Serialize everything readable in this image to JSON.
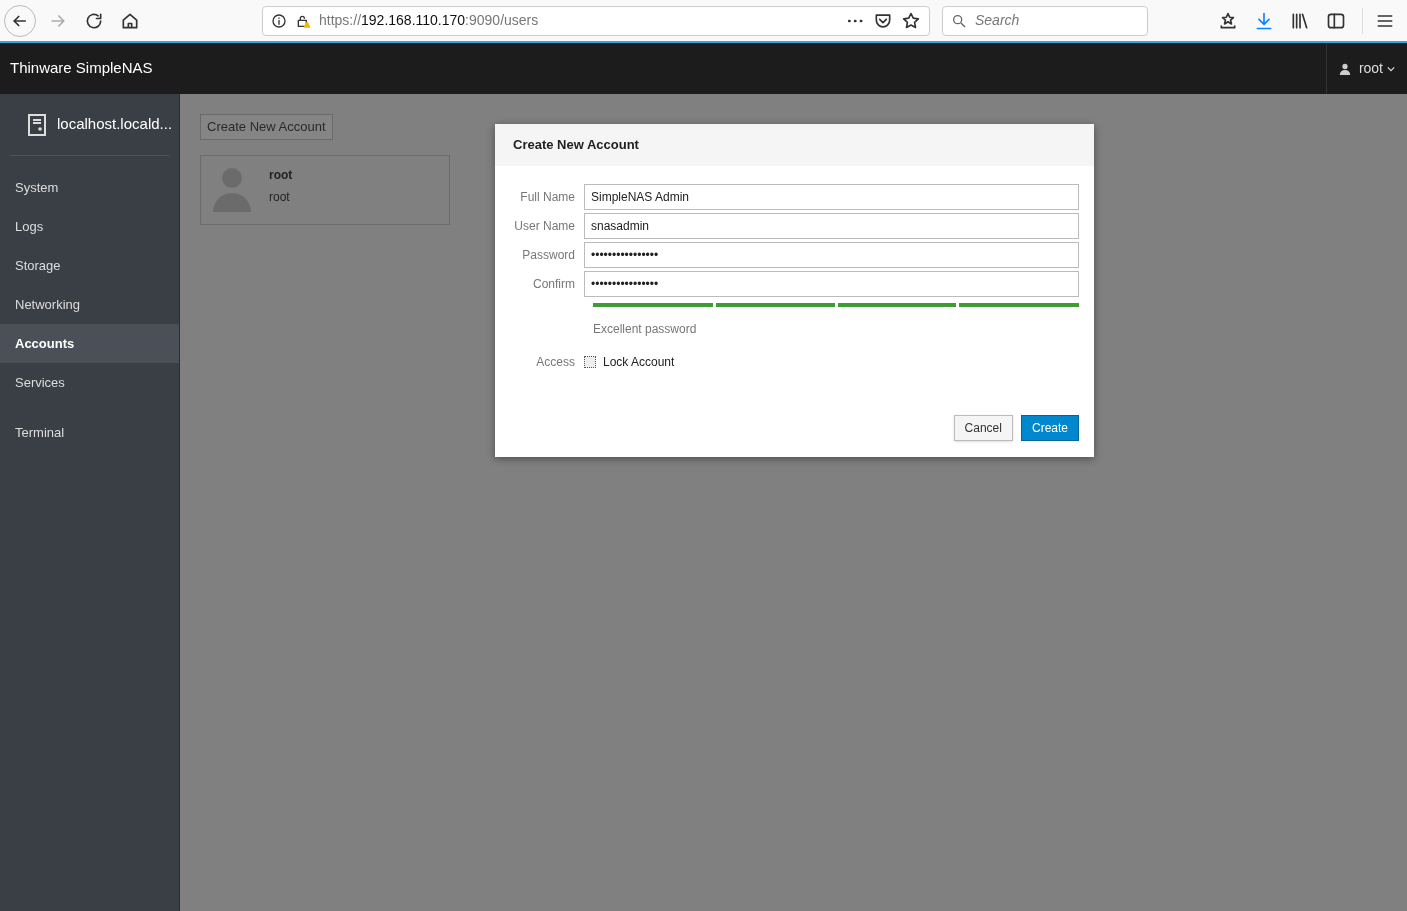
{
  "browser": {
    "url": {
      "scheme": "https://",
      "host": "192.168.110.170",
      "rest": ":9090/users"
    },
    "search": {
      "placeholder": "Search"
    }
  },
  "header": {
    "brand": "Thinware SimpleNAS",
    "user": "root"
  },
  "sidebar": {
    "host": "localhost.locald...",
    "items": [
      {
        "label": "System",
        "selected": false
      },
      {
        "label": "Logs",
        "selected": false
      },
      {
        "label": "Storage",
        "selected": false
      },
      {
        "label": "Networking",
        "selected": false
      },
      {
        "label": "Accounts",
        "selected": true
      },
      {
        "label": "Services",
        "selected": false
      },
      {
        "label": "Terminal",
        "selected": false
      }
    ]
  },
  "main": {
    "create_button": "Create New Account",
    "accounts": [
      {
        "name": "root",
        "login": "root"
      }
    ]
  },
  "dialog": {
    "title": "Create New Account",
    "fields": [
      {
        "label": "Full Name",
        "value": "SimpleNAS Admin"
      },
      {
        "label": "User Name",
        "value": "snasadmin"
      },
      {
        "label": "Password",
        "value": "••••••••••••••••"
      },
      {
        "label": "Confirm",
        "value": "••••••••••••••••"
      }
    ],
    "strength": {
      "level": 1,
      "text": "Excellent password"
    },
    "access": {
      "label": "Access",
      "option": "Lock Account",
      "checked": false
    },
    "buttons": {
      "cancel": "Cancel",
      "create": "Create"
    }
  }
}
